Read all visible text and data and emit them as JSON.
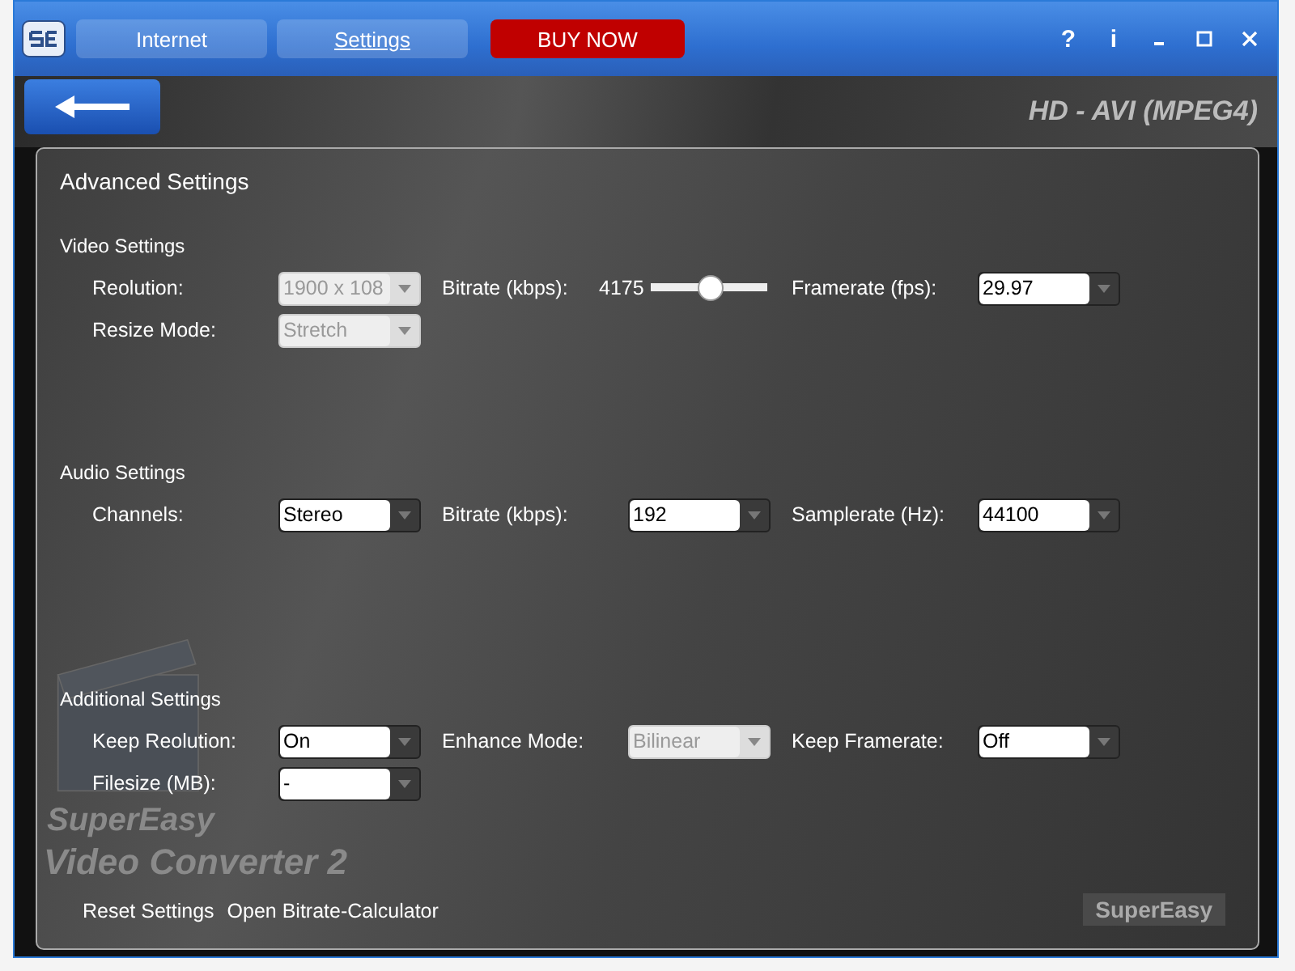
{
  "title_bar": {
    "tabs": [
      {
        "label": "Internet",
        "kind": "tab",
        "selected": false
      },
      {
        "label": "Settings",
        "kind": "tab",
        "selected": true
      },
      {
        "label": "BUY NOW",
        "kind": "buy",
        "selected": false
      }
    ],
    "controls": [
      "?",
      "i"
    ]
  },
  "header": {
    "profile": "HD - AVI (MPEG4)"
  },
  "panel": {
    "title": "Advanced Settings",
    "sections": [
      {
        "title": "Video Settings",
        "rows": [
          [
            {
              "kind": "combo",
              "label": "Reolution:",
              "value": "1900 x 108",
              "disabled": true
            },
            {
              "kind": "slider",
              "label": "Bitrate (kbps):",
              "value": "4175",
              "level": 0.52
            },
            {
              "kind": "combo",
              "label": "Framerate (fps):",
              "value": "29.97",
              "disabled": false
            }
          ],
          [
            {
              "kind": "combo",
              "label": "Resize Mode:",
              "value": "Stretch",
              "disabled": true
            }
          ]
        ]
      },
      {
        "title": "Audio Settings",
        "rows": [
          [
            {
              "kind": "combo",
              "label": "Channels:",
              "value": "Stereo",
              "disabled": false
            },
            {
              "kind": "combo",
              "label": "Bitrate (kbps):",
              "value": "192",
              "disabled": false
            },
            {
              "kind": "combo",
              "label": "Samplerate (Hz):",
              "value": "44100",
              "disabled": false
            }
          ]
        ]
      },
      {
        "title": "Additional Settings",
        "rows": [
          [
            {
              "kind": "combo",
              "label": "Keep Reolution:",
              "value": "On",
              "disabled": false
            },
            {
              "kind": "combo",
              "label": "Enhance Mode:",
              "value": "Bilinear",
              "disabled": true
            },
            {
              "kind": "combo",
              "label": "Keep Framerate:",
              "value": "Off",
              "disabled": false
            }
          ],
          [
            {
              "kind": "combo",
              "label": "Filesize (MB):",
              "value": "-",
              "disabled": false
            }
          ]
        ]
      }
    ],
    "links": [
      "Reset Settings",
      "Open Bitrate-Calculator"
    ],
    "artwork_text": [
      "SuperEasy",
      "Video Converter 2"
    ],
    "brand": "SuperEasy"
  }
}
